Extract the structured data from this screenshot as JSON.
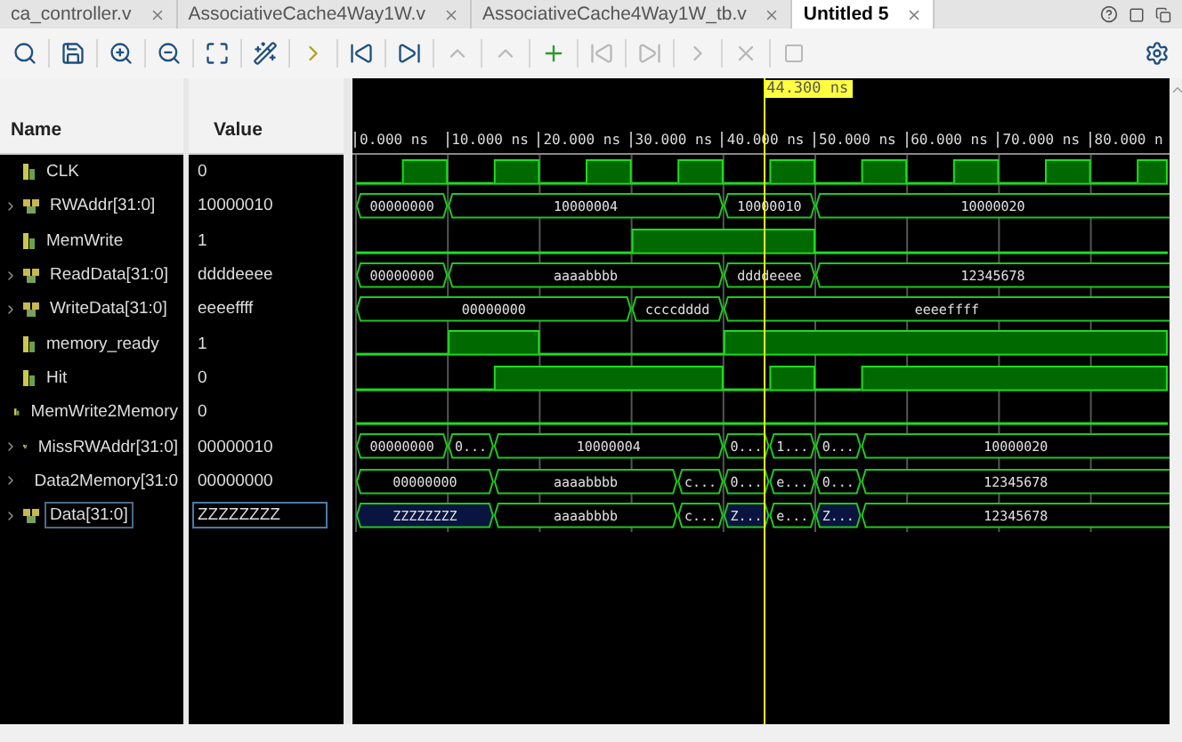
{
  "tabs": [
    {
      "label": "ca_controller.v",
      "selected": false
    },
    {
      "label": "AssociativeCache4Way1W.v",
      "selected": false
    },
    {
      "label": "AssociativeCache4Way1W_tb.v",
      "selected": false
    },
    {
      "label": "Untitled 5",
      "selected": true
    }
  ],
  "columns": {
    "name": "Name",
    "value": "Value"
  },
  "cursor": {
    "label": "44.300 ns"
  },
  "time_axis": [
    "0.000 ns",
    "10.000 ns",
    "20.000 ns",
    "30.000 ns",
    "40.000 ns",
    "50.000 ns",
    "60.000 ns",
    "70.000 ns",
    "80.000 n"
  ],
  "signals": [
    {
      "name": "CLK",
      "value": "0",
      "kind": "bit",
      "selected": false,
      "segments": [
        {
          "high": false
        },
        {
          "high": true
        },
        {
          "high": false
        },
        {
          "high": true
        },
        {
          "high": false
        },
        {
          "high": true
        },
        {
          "high": false
        },
        {
          "high": true
        },
        {
          "high": false
        },
        {
          "high": true
        },
        {
          "high": false
        },
        {
          "high": true
        },
        {
          "high": false
        },
        {
          "high": true
        },
        {
          "high": false
        },
        {
          "high": true
        },
        {
          "high": false
        },
        {
          "high": true
        }
      ]
    },
    {
      "name": "RWAddr[31:0]",
      "value": "10000010",
      "kind": "bus",
      "selected": false,
      "segments": [
        {
          "label": "00000000"
        },
        {
          "label": "10000004"
        },
        {
          "label": "10000010"
        },
        {
          "label": "10000020"
        }
      ]
    },
    {
      "name": "MemWrite",
      "value": "1",
      "kind": "bit",
      "selected": false,
      "segments": [
        {
          "high": false
        },
        {
          "high": true
        },
        {
          "high": false
        }
      ]
    },
    {
      "name": "ReadData[31:0]",
      "value": "ddddeeee",
      "kind": "bus",
      "selected": false,
      "segments": [
        {
          "label": "00000000"
        },
        {
          "label": "aaaabbbb"
        },
        {
          "label": "ddddeeee"
        },
        {
          "label": "12345678"
        }
      ]
    },
    {
      "name": "WriteData[31:0]",
      "value": "eeeeffff",
      "kind": "bus",
      "selected": false,
      "segments": [
        {
          "label": "00000000"
        },
        {
          "label": "ccccdddd"
        },
        {
          "label": "eeeeffff"
        }
      ]
    },
    {
      "name": "memory_ready",
      "value": "1",
      "kind": "bit",
      "selected": false,
      "segments": [
        {
          "high": false
        },
        {
          "high": true
        },
        {
          "high": false
        },
        {
          "high": true
        }
      ]
    },
    {
      "name": "Hit",
      "value": "0",
      "kind": "bit",
      "selected": false,
      "segments": [
        {
          "high": false
        },
        {
          "high": true
        },
        {
          "high": false
        },
        {
          "high": true
        },
        {
          "high": false
        },
        {
          "high": true
        }
      ]
    },
    {
      "name": "MemWrite2Memory",
      "value": "0",
      "kind": "bit",
      "selected": false,
      "segments": [
        {
          "high": false
        }
      ]
    },
    {
      "name": "MissRWAddr[31:0]",
      "value": "00000010",
      "kind": "bus",
      "selected": false,
      "segments": [
        {
          "label": "00000000"
        },
        {
          "label": "0..."
        },
        {
          "label": "10000004"
        },
        {
          "label": "0..."
        },
        {
          "label": "1..."
        },
        {
          "label": "0..."
        },
        {
          "label": "10000020"
        }
      ]
    },
    {
      "name": "Data2Memory[31:0",
      "value": "00000000",
      "kind": "bus",
      "selected": false,
      "segments": [
        {
          "label": "00000000"
        },
        {
          "label": "aaaabbbb"
        },
        {
          "label": "c..."
        },
        {
          "label": "0..."
        },
        {
          "label": "e..."
        },
        {
          "label": "0..."
        },
        {
          "label": "12345678"
        }
      ]
    },
    {
      "name": "Data[31:0]",
      "value": "ZZZZZZZZ",
      "kind": "bus",
      "selected": true,
      "segments": [
        {
          "label": "ZZZZZZZZ",
          "highz": true
        },
        {
          "label": "aaaabbbb",
          "highz": false
        },
        {
          "label": "c...",
          "highz": false
        },
        {
          "label": "Z...",
          "highz": true
        },
        {
          "label": "e...",
          "highz": false
        },
        {
          "label": "Z...",
          "highz": true
        },
        {
          "label": "12345678",
          "highz": false
        }
      ]
    }
  ]
}
